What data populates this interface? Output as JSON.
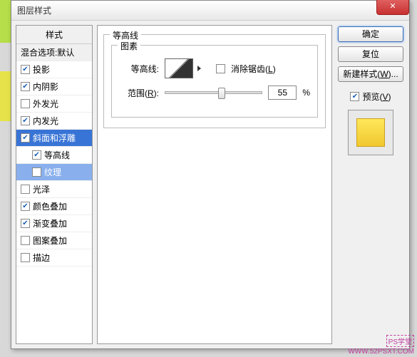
{
  "dialog": {
    "title": "图层样式"
  },
  "left": {
    "header": "样式",
    "blend": "混合选项:默认",
    "items": [
      {
        "label": "投影",
        "checked": true
      },
      {
        "label": "内阴影",
        "checked": true
      },
      {
        "label": "外发光",
        "checked": false
      },
      {
        "label": "内发光",
        "checked": true
      },
      {
        "label": "斜面和浮雕",
        "checked": true,
        "selectedParent": true
      },
      {
        "label": "等高线",
        "checked": true,
        "sub": true
      },
      {
        "label": "纹理",
        "checked": false,
        "sub": true,
        "selected": true
      },
      {
        "label": "光泽",
        "checked": false
      },
      {
        "label": "颜色叠加",
        "checked": true
      },
      {
        "label": "渐变叠加",
        "checked": true
      },
      {
        "label": "图案叠加",
        "checked": false
      },
      {
        "label": "描边",
        "checked": false
      }
    ]
  },
  "mid": {
    "group_title": "等高线",
    "subgroup_title": "图素",
    "contour_label": "等高线:",
    "antialias_label": "消除锯齿(",
    "antialias_key": "L",
    "antialias_end": ")",
    "range_label": "范围(",
    "range_key": "R",
    "range_end": "):",
    "range_value": "55",
    "percent": "%"
  },
  "right": {
    "ok": "确定",
    "reset": "复位",
    "newstyle": "新建样式(",
    "newstyle_key": "W",
    "newstyle_end": ")...",
    "preview_label": "预览(",
    "preview_key": "V",
    "preview_end": ")"
  },
  "watermark": {
    "line1": "PS学堂",
    "line2": "WWW.52PSXT.COM"
  }
}
